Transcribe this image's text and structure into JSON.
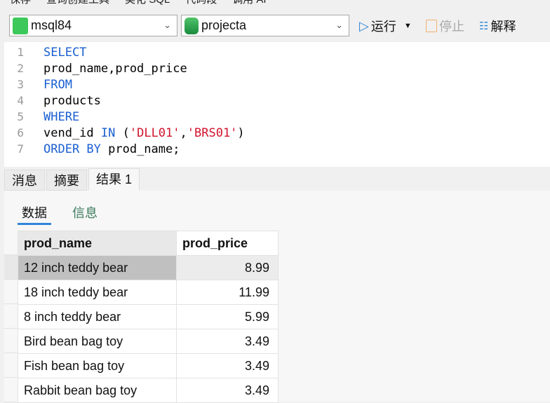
{
  "top_toolbar": [
    "保存",
    "查询创建工具",
    "美化 SQL",
    "代码段",
    "调用 AI"
  ],
  "connection": {
    "value": "msql84",
    "icon": "mysql-dolphin-icon"
  },
  "database": {
    "value": "projecta",
    "icon": "database-icon"
  },
  "buttons": {
    "run": "运行",
    "stop": "停止",
    "explain": "解释"
  },
  "editor": {
    "lines": [
      {
        "n": "1",
        "parts": [
          {
            "t": "SELECT",
            "c": "kw"
          }
        ]
      },
      {
        "n": "2",
        "parts": [
          {
            "t": "prod_name,prod_price",
            "c": ""
          }
        ]
      },
      {
        "n": "3",
        "parts": [
          {
            "t": "FROM",
            "c": "kw"
          }
        ]
      },
      {
        "n": "4",
        "parts": [
          {
            "t": "products",
            "c": ""
          }
        ]
      },
      {
        "n": "5",
        "parts": [
          {
            "t": "WHERE",
            "c": "kw"
          }
        ]
      },
      {
        "n": "6",
        "parts": [
          {
            "t": "vend_id ",
            "c": ""
          },
          {
            "t": "IN",
            "c": "kw"
          },
          {
            "t": " (",
            "c": ""
          },
          {
            "t": "'DLL01'",
            "c": "str"
          },
          {
            "t": ",",
            "c": ""
          },
          {
            "t": "'BRS01'",
            "c": "str"
          },
          {
            "t": ")",
            "c": ""
          }
        ]
      },
      {
        "n": "7",
        "parts": [
          {
            "t": "ORDER BY",
            "c": "kw"
          },
          {
            "t": " prod_name;",
            "c": ""
          }
        ]
      }
    ]
  },
  "result_tabs": [
    "消息",
    "摘要",
    "结果 1"
  ],
  "sub_tabs": [
    "数据",
    "信息"
  ],
  "table": {
    "columns": [
      "prod_name",
      "prod_price"
    ],
    "rows": [
      [
        "12 inch teddy bear",
        "8.99"
      ],
      [
        "18 inch teddy bear",
        "11.99"
      ],
      [
        "8 inch teddy bear",
        "5.99"
      ],
      [
        "Bird bean bag toy",
        "3.49"
      ],
      [
        "Fish bean bag toy",
        "3.49"
      ],
      [
        "Rabbit bean bag toy",
        "3.49"
      ]
    ]
  }
}
